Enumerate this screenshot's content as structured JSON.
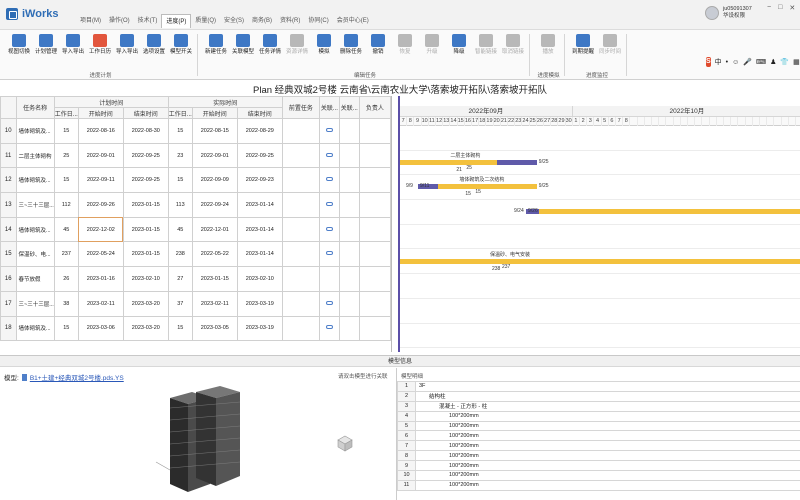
{
  "app": {
    "name": "iWorks"
  },
  "menu": [
    {
      "label": "项目(M)",
      "active": false
    },
    {
      "label": "操作(O)",
      "active": false
    },
    {
      "label": "技术(T)",
      "active": false
    },
    {
      "label": "进度(P)",
      "active": true
    },
    {
      "label": "质量(Q)",
      "active": false
    },
    {
      "label": "安全(S)",
      "active": false
    },
    {
      "label": "商务(B)",
      "active": false
    },
    {
      "label": "资料(R)",
      "active": false
    },
    {
      "label": "协同(C)",
      "active": false
    },
    {
      "label": "会员中心(E)",
      "active": false
    }
  ],
  "user": {
    "id": "ju05091307",
    "role": "华设权限"
  },
  "window_controls": [
    "−",
    "□",
    "✕"
  ],
  "ribbon": {
    "groups": [
      {
        "label": "进度计划",
        "buttons": [
          {
            "label": "视图切换",
            "icon": "view-switch-icon",
            "color": "#3e78c5",
            "disabled": false
          },
          {
            "label": "计划管理",
            "icon": "plan-manage-icon",
            "color": "#3e78c5",
            "disabled": false
          },
          {
            "label": "导入导出",
            "icon": "import-export-icon",
            "color": "#3e78c5",
            "disabled": false
          },
          {
            "label": "工作日历",
            "icon": "calendar-icon",
            "color": "#e2563d",
            "disabled": false
          },
          {
            "label": "导入导出",
            "icon": "import-export-icon",
            "color": "#3e78c5",
            "disabled": false
          },
          {
            "label": "选项设置",
            "icon": "gear-icon",
            "color": "#3e78c5",
            "disabled": false
          },
          {
            "label": "模型开关",
            "icon": "model-toggle-icon",
            "color": "#3e78c5",
            "disabled": false
          }
        ]
      },
      {
        "label": "编辑任务",
        "buttons": [
          {
            "label": "新建任务",
            "icon": "new-task-icon",
            "color": "#3e78c5",
            "disabled": false
          },
          {
            "label": "关联模型",
            "icon": "link-model-icon",
            "color": "#3e78c5",
            "disabled": false
          },
          {
            "label": "任务详情",
            "icon": "task-detail-icon",
            "color": "#3e78c5",
            "disabled": false
          },
          {
            "label": "资源详情",
            "icon": "resource-icon",
            "color": "#b8b8b8",
            "disabled": true
          },
          {
            "label": "模拟",
            "icon": "simulate-icon",
            "color": "#3e78c5",
            "disabled": false
          },
          {
            "label": "删除任务",
            "icon": "delete-task-icon",
            "color": "#3e78c5",
            "disabled": false
          },
          {
            "label": "撤销",
            "icon": "undo-icon",
            "color": "#3e78c5",
            "disabled": false
          },
          {
            "label": "恢复",
            "icon": "redo-icon",
            "color": "#b8b8b8",
            "disabled": true
          },
          {
            "label": "升级",
            "icon": "upgrade-icon",
            "color": "#b8b8b8",
            "disabled": true
          },
          {
            "label": "降级",
            "icon": "downgrade-icon",
            "color": "#3e78c5",
            "disabled": false
          },
          {
            "label": "智能链接",
            "icon": "smart-link-icon",
            "color": "#b8b8b8",
            "disabled": true
          },
          {
            "label": "取消链接",
            "icon": "unlink-icon",
            "color": "#b8b8b8",
            "disabled": true
          }
        ]
      },
      {
        "label": "进度模拟",
        "buttons": [
          {
            "label": "播放",
            "icon": "play-icon",
            "color": "#b8b8b8",
            "disabled": true
          }
        ]
      },
      {
        "label": "进度监控",
        "buttons": [
          {
            "label": "到期提醒",
            "icon": "reminder-icon",
            "color": "#3e78c5",
            "disabled": false
          },
          {
            "label": "同步时间",
            "icon": "sync-time-icon",
            "color": "#b8b8b8",
            "disabled": true
          }
        ]
      }
    ]
  },
  "ime": {
    "s": "S",
    "items": [
      "中",
      "•",
      "☺",
      "🎤",
      "⌨",
      "♟",
      "👕",
      "▦"
    ]
  },
  "plan_title": "Plan 经典双城2号楼 云南省\\云南农业大学\\落索坡开拓队\\落索坡开拓队",
  "grid": {
    "header1": {
      "name": "任务名称",
      "plan": "计划时间",
      "actual": "实际时间",
      "pre": "前置任务",
      "assoc1": "关联...",
      "assoc2": "关联...",
      "owner": "负责人"
    },
    "header2": [
      "工作日...",
      "开始时间",
      "结束时间",
      "工作日...",
      "开始时间",
      "结束时间"
    ],
    "rows": [
      {
        "n": "10",
        "name": "墙体砌筑及...",
        "pd": "15",
        "ps": "2022-08-16",
        "pe": "2022-08-30",
        "ad": "15",
        "as": "2022-08-15",
        "ae": "2022-08-29",
        "link": true,
        "sel": false
      },
      {
        "n": "11",
        "name": "二层主体砌构",
        "pd": "25",
        "ps": "2022-09-01",
        "pe": "2022-09-25",
        "ad": "23",
        "as": "2022-09-01",
        "ae": "2022-09-25",
        "link": true,
        "sel": false
      },
      {
        "n": "12",
        "name": "墙体砌筑及...",
        "pd": "15",
        "ps": "2022-09-11",
        "pe": "2022-09-25",
        "ad": "15",
        "as": "2022-09-09",
        "ae": "2022-09-23",
        "link": true,
        "sel": false
      },
      {
        "n": "13",
        "name": "三~三十三层...",
        "pd": "112",
        "ps": "2022-09-26",
        "pe": "2023-01-15",
        "ad": "113",
        "as": "2022-09-24",
        "ae": "2023-01-14",
        "link": true,
        "sel": false
      },
      {
        "n": "14",
        "name": "墙体砌筑及...",
        "pd": "45",
        "ps": "2022-12-02",
        "pe": "2023-01-15",
        "ad": "45",
        "as": "2022-12-01",
        "ae": "2023-01-14",
        "link": true,
        "sel": true
      },
      {
        "n": "15",
        "name": "保温砂、电...",
        "pd": "237",
        "ps": "2022-05-24",
        "pe": "2023-01-15",
        "ad": "238",
        "as": "2022-05-22",
        "ae": "2023-01-14",
        "link": true,
        "sel": false
      },
      {
        "n": "16",
        "name": "春节放假",
        "pd": "26",
        "ps": "2023-01-16",
        "pe": "2023-02-10",
        "ad": "27",
        "as": "2023-01-15",
        "ae": "2023-02-10",
        "link": false,
        "sel": false
      },
      {
        "n": "17",
        "name": "三~三十三层...",
        "pd": "38",
        "ps": "2023-02-11",
        "pe": "2023-03-20",
        "ad": "37",
        "as": "2023-02-11",
        "ae": "2023-03-19",
        "link": true,
        "sel": false
      },
      {
        "n": "18",
        "name": "墙体砌筑及...",
        "pd": "15",
        "ps": "2023-03-06",
        "pe": "2023-03-20",
        "ad": "15",
        "as": "2023-03-05",
        "ae": "2023-03-19",
        "link": true,
        "sel": false
      }
    ]
  },
  "gantt": {
    "months": [
      {
        "label": "2022年09月",
        "start_day": "7",
        "days": 24
      },
      {
        "label": "2022年10月",
        "start_day": "1",
        "days": 8
      }
    ],
    "days": [
      "7",
      "8",
      "9",
      "10",
      "11",
      "12",
      "13",
      "14",
      "15",
      "16",
      "17",
      "18",
      "19",
      "20",
      "21",
      "22",
      "23",
      "24",
      "25",
      "26",
      "27",
      "28",
      "29",
      "30",
      "1",
      "2",
      "3",
      "4",
      "5",
      "6",
      "7",
      "8"
    ],
    "bars": [
      {
        "row": 1,
        "label_top": "二层主体砌构",
        "left_text": "",
        "right_text": "9/25",
        "start": -1,
        "end": 19,
        "crit_start": 13.5,
        "crit_end": 19,
        "below": [
          "21",
          "25"
        ]
      },
      {
        "row": 2,
        "label_top": "墙体砌筑及二次结构",
        "left_text": "9/9",
        "right_text": "9/25",
        "start": 2.5,
        "end": 19,
        "crit_start": 2.5,
        "crit_end": 5.3,
        "inner": "9/11",
        "below": [
          "15",
          "15"
        ]
      },
      {
        "row": 3,
        "label_top": "",
        "left_text": "9/24",
        "right_text": "",
        "start": 17.5,
        "end": 60,
        "crit_start": 17.5,
        "crit_end": 19.3,
        "inner": "9/26",
        "below": []
      },
      {
        "row": 5,
        "label_top": "保温砂、电气安装",
        "left_text": "",
        "right_text": "",
        "start": -1,
        "end": 60,
        "crit_start": -1,
        "crit_end": -1,
        "below": [
          "238",
          "237"
        ]
      }
    ]
  },
  "model": {
    "header": "模型信息",
    "file_label": "模型:",
    "file_name": "B1+土建+经典双城2号楼.pds.YS",
    "hint": "请双击模型进行关联",
    "right_title": "模型明细",
    "props": [
      {
        "n": "1",
        "v": "3F",
        "indent": 0
      },
      {
        "n": "2",
        "v": "结构柱",
        "indent": 1
      },
      {
        "n": "3",
        "v": "混凝土 - 正方形 - 柱",
        "indent": 2
      },
      {
        "n": "4",
        "v": "100*200mm",
        "indent": 3
      },
      {
        "n": "5",
        "v": "100*200mm",
        "indent": 3
      },
      {
        "n": "6",
        "v": "100*200mm",
        "indent": 3
      },
      {
        "n": "7",
        "v": "100*200mm",
        "indent": 3
      },
      {
        "n": "8",
        "v": "100*200mm",
        "indent": 3
      },
      {
        "n": "9",
        "v": "100*200mm",
        "indent": 3
      },
      {
        "n": "10",
        "v": "100*200mm",
        "indent": 3
      },
      {
        "n": "11",
        "v": "100*200mm",
        "indent": 3
      }
    ]
  }
}
